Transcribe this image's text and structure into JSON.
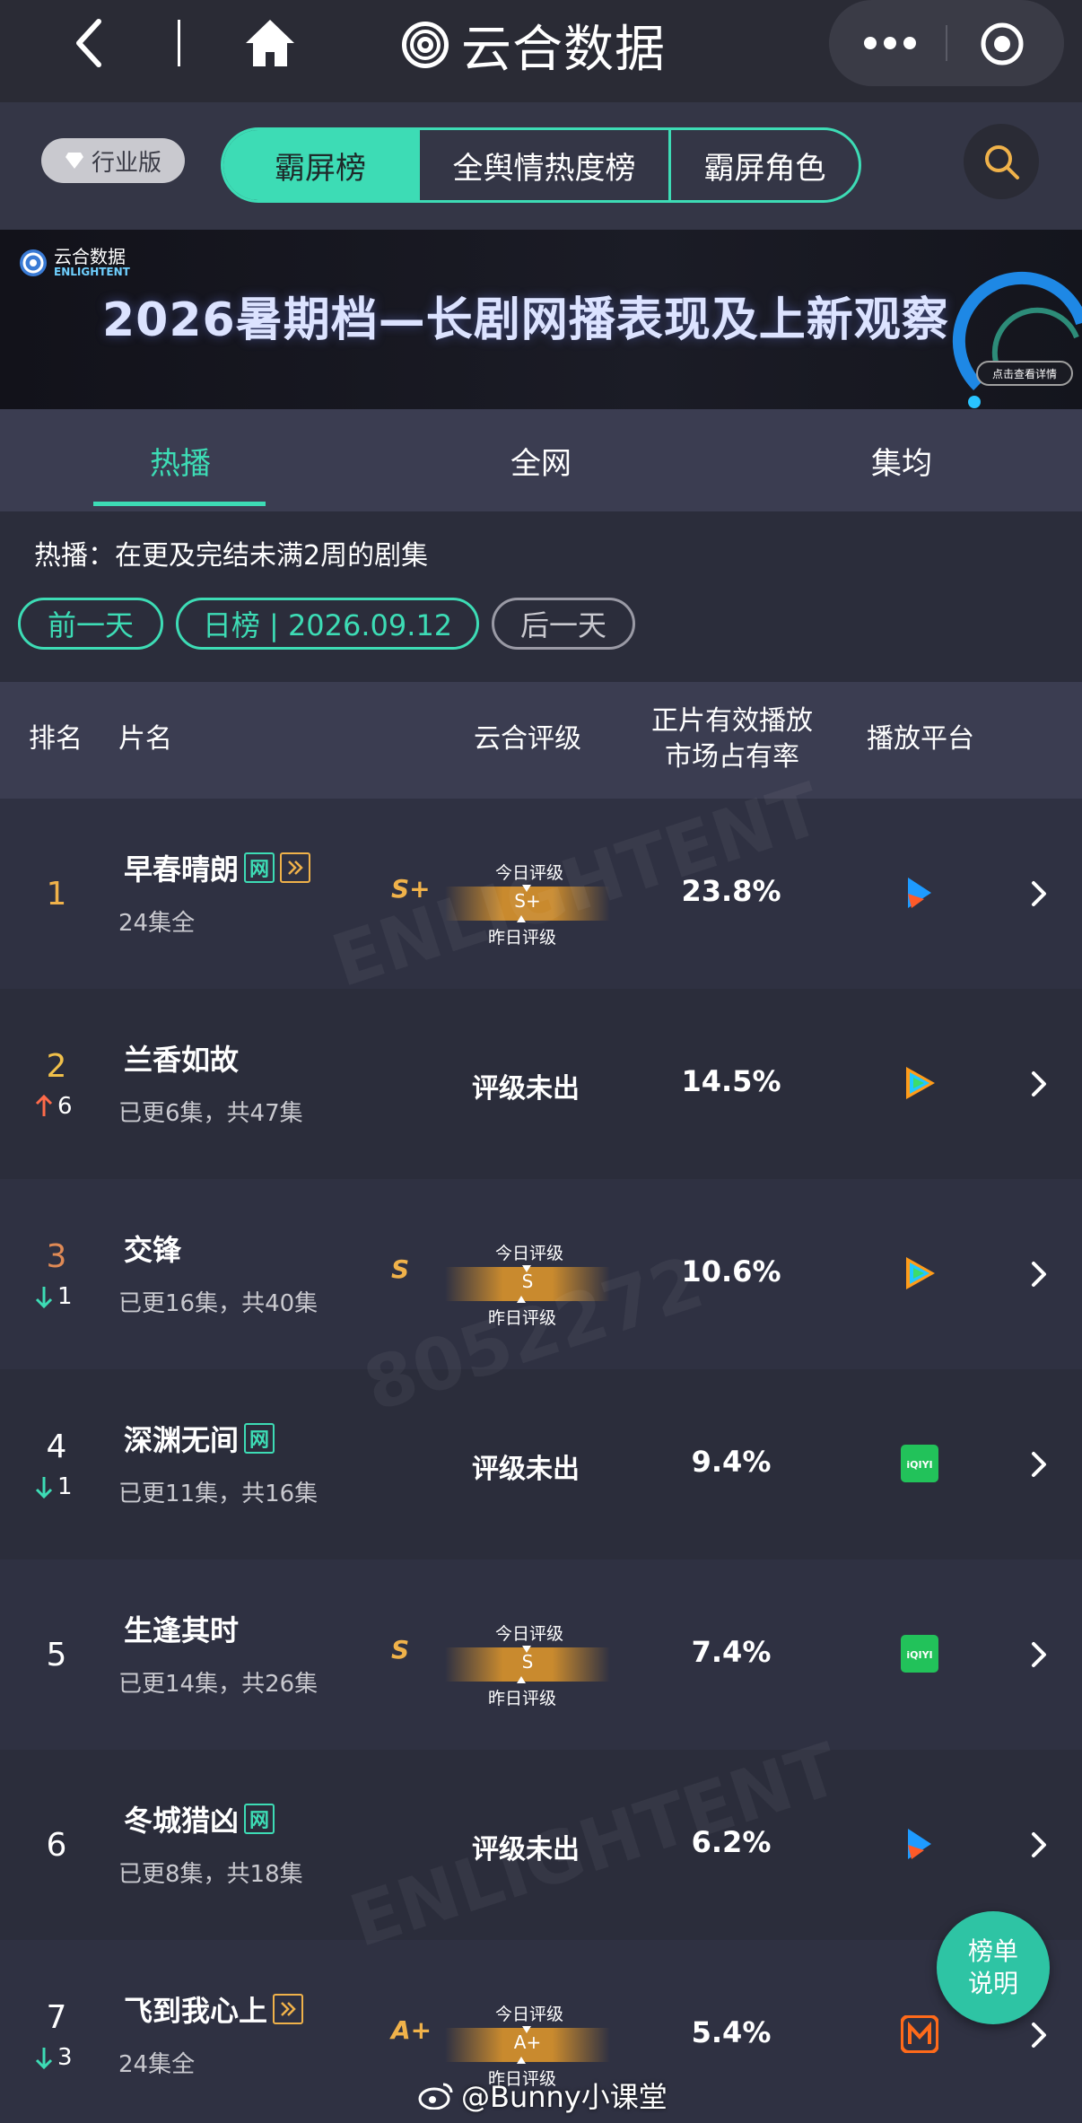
{
  "topbar": {
    "brand": "云合数据"
  },
  "filter": {
    "industry": "行业版",
    "segments": [
      "霸屏榜",
      "全舆情热度榜",
      "霸屏角色"
    ]
  },
  "banner": {
    "logo_cn": "云合数据",
    "logo_en": "ENLIGHTENT",
    "title": "2026暑期档—长剧网播表现及上新观察",
    "detail": "点击查看详情"
  },
  "tabs": [
    "热播",
    "全网",
    "集均"
  ],
  "info": "热播：在更及完结未满2周的剧集",
  "date": {
    "prev": "前一天",
    "current": "日榜 | 2026.09.12",
    "next": "后一天"
  },
  "table_header": {
    "rank": "排名",
    "title": "片名",
    "grade": "云合评级",
    "share_line1": "正片有效播放",
    "share_line2": "市场占有率",
    "platform": "播放平台"
  },
  "grade_labels": {
    "today": "今日评级",
    "yesterday": "昨日评级",
    "none": "评级未出"
  },
  "rows": [
    {
      "rank": "1",
      "move": "",
      "name": "早春晴朗",
      "sub": "24集全",
      "grade": "S+",
      "share": "23.8%",
      "platform": "youku"
    },
    {
      "rank": "2",
      "move": "6",
      "name": "兰香如故",
      "sub": "已更6集，共47集",
      "grade": "",
      "share": "14.5%",
      "platform": "tencent"
    },
    {
      "rank": "3",
      "move": "1",
      "name": "交锋",
      "sub": "已更16集，共40集",
      "grade": "S",
      "share": "10.6%",
      "platform": "tencent"
    },
    {
      "rank": "4",
      "move": "1",
      "name": "深渊无间",
      "sub": "已更11集，共16集",
      "grade": "",
      "share": "9.4%",
      "platform": "iqiyi"
    },
    {
      "rank": "5",
      "move": "",
      "name": "生逢其时",
      "sub": "已更14集，共26集",
      "grade": "S",
      "share": "7.4%",
      "platform": "iqiyi"
    },
    {
      "rank": "6",
      "move": "",
      "name": "冬城猎凶",
      "sub": "已更8集，共18集",
      "grade": "",
      "share": "6.2%",
      "platform": "youku"
    },
    {
      "rank": "7",
      "move": "3",
      "name": "飞到我心上",
      "sub": "24集全",
      "grade": "A+",
      "share": "5.4%",
      "platform": "mgtv"
    }
  ],
  "badges": {
    "net": "网"
  },
  "iqiyi_label": "iQIYI",
  "float_button": {
    "line1": "榜单",
    "line2": "说明"
  },
  "weibo": "@Bunny小课堂",
  "colors": {
    "accent": "#3ddcb5",
    "gold": "#f0b24a",
    "up": "#ff6b4a",
    "down": "#3ddcb5"
  }
}
